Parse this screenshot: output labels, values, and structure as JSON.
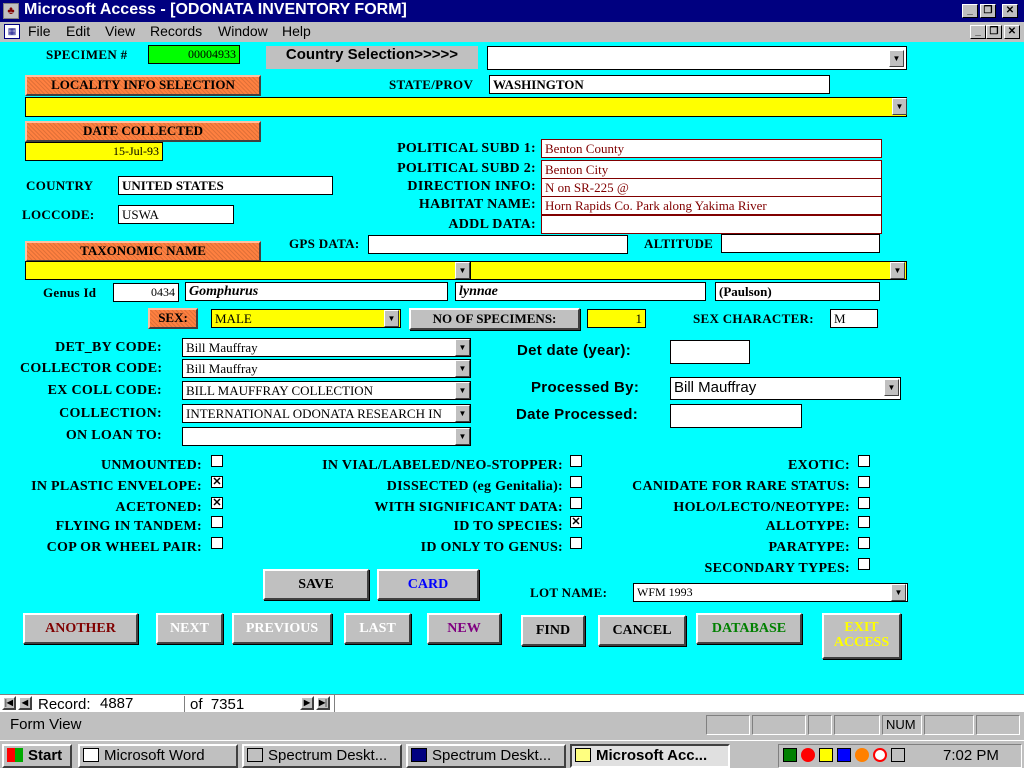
{
  "window": {
    "title": "Microsoft Access - [ODONATA INVENTORY FORM]"
  },
  "menu": [
    "File",
    "Edit",
    "View",
    "Records",
    "Window",
    "Help"
  ],
  "specimen": {
    "label": "SPECIMEN #",
    "value": "00004933"
  },
  "country_selection": {
    "label": "Country Selection>>>>>",
    "value": ""
  },
  "locality": {
    "button": "LOCALITY INFO SELECTION",
    "value": ""
  },
  "state": {
    "label": "STATE/PROV",
    "value": "WASHINGTON"
  },
  "date_collected": {
    "button": "DATE COLLECTED",
    "value": "15-Jul-93"
  },
  "political1": {
    "label": "POLITICAL SUBD 1:",
    "value": "Benton County"
  },
  "political2": {
    "label": "POLITICAL SUBD 2:",
    "value": "Benton City"
  },
  "direction": {
    "label": "DIRECTION INFO:",
    "value": "N on SR-225 @"
  },
  "habitat": {
    "label": "HABITAT NAME:",
    "value": "Horn Rapids Co. Park along Yakima River"
  },
  "addl": {
    "label": "ADDL DATA:",
    "value": ""
  },
  "country": {
    "label": "COUNTRY",
    "value": "UNITED STATES"
  },
  "loccode": {
    "label": "LOCCODE:",
    "value": "USWA"
  },
  "taxonomic": {
    "button": "TAXONOMIC NAME",
    "value1": "",
    "value2": ""
  },
  "gps": {
    "label": "GPS DATA:",
    "value": ""
  },
  "altitude": {
    "label": "ALTITUDE",
    "value": ""
  },
  "genus": {
    "label": "Genus Id",
    "id": "0434",
    "genus": "Gomphurus",
    "species": "lynnae",
    "author": "(Paulson)"
  },
  "sex": {
    "button": "SEX:",
    "value": "MALE"
  },
  "no_specimens": {
    "button": "NO OF SPECIMENS:",
    "value": "1"
  },
  "sex_character": {
    "label": "SEX CHARACTER:",
    "value": "M"
  },
  "det_by": {
    "label": "DET_BY CODE:",
    "value": "Bill Mauffray"
  },
  "collector": {
    "label": "COLLECTOR CODE:",
    "value": "Bill Mauffray"
  },
  "ex_coll": {
    "label": "EX COLL CODE:",
    "value": "BILL MAUFFRAY  COLLECTION"
  },
  "collection": {
    "label": "COLLECTION:",
    "value": "INTERNATIONAL ODONATA RESEARCH IN"
  },
  "on_loan": {
    "label": "ON LOAN TO:",
    "value": ""
  },
  "det_date": {
    "label": "Det date (year):",
    "value": ""
  },
  "processed_by": {
    "label": "Processed By:",
    "value": "Bill Mauffray"
  },
  "date_processed": {
    "label": "Date Processed:",
    "value": ""
  },
  "checks": {
    "unmounted": {
      "label": "UNMOUNTED:",
      "checked": false
    },
    "plastic": {
      "label": "IN PLASTIC ENVELOPE:",
      "checked": true
    },
    "acetoned": {
      "label": "ACETONED:",
      "checked": true
    },
    "tandem": {
      "label": "FLYING IN TANDEM:",
      "checked": false
    },
    "cop": {
      "label": "COP OR WHEEL PAIR:",
      "checked": false
    },
    "vial": {
      "label": "IN VIAL/LABELED/NEO-STOPPER:",
      "checked": false
    },
    "dissected": {
      "label": "DISSECTED (eg Genitalia):",
      "checked": false
    },
    "significant": {
      "label": "WITH SIGNIFICANT DATA:",
      "checked": false
    },
    "id_species": {
      "label": "ID TO SPECIES:",
      "checked": true
    },
    "id_genus": {
      "label": "ID ONLY TO GENUS:",
      "checked": false
    },
    "exotic": {
      "label": "EXOTIC:",
      "checked": false
    },
    "rare": {
      "label": "CANIDATE FOR RARE STATUS:",
      "checked": false
    },
    "holo": {
      "label": "HOLO/LECTO/NEOTYPE:",
      "checked": false
    },
    "allotype": {
      "label": "ALLOTYPE:",
      "checked": false
    },
    "paratype": {
      "label": "PARATYPE:",
      "checked": false
    },
    "secondary": {
      "label": "SECONDARY TYPES:",
      "checked": false
    }
  },
  "buttons": {
    "save": "SAVE",
    "card": "CARD",
    "another": "ANOTHER",
    "next": "NEXT",
    "previous": "PREVIOUS",
    "last": "LAST",
    "new": "NEW",
    "find": "FIND",
    "cancel": "CANCEL",
    "database": "DATABASE",
    "exit1": "EXIT",
    "exit2": "ACCESS"
  },
  "lot": {
    "label": "LOT NAME:",
    "value": "WFM 1993"
  },
  "nav": {
    "label": "Record:",
    "record": "4887",
    "of": "of  7351"
  },
  "status": {
    "view": "Form View",
    "num": "NUM"
  },
  "taskbar": {
    "start": "Start",
    "tasks": [
      "Microsoft Word",
      "Spectrum Deskt...",
      "Spectrum Deskt...",
      "Microsoft Acc..."
    ],
    "clock": "7:02 PM"
  },
  "colors": {
    "form_bg": "#00ffff",
    "yellow": "#ffff00",
    "orange": "#ff8040",
    "title": "#000080"
  }
}
